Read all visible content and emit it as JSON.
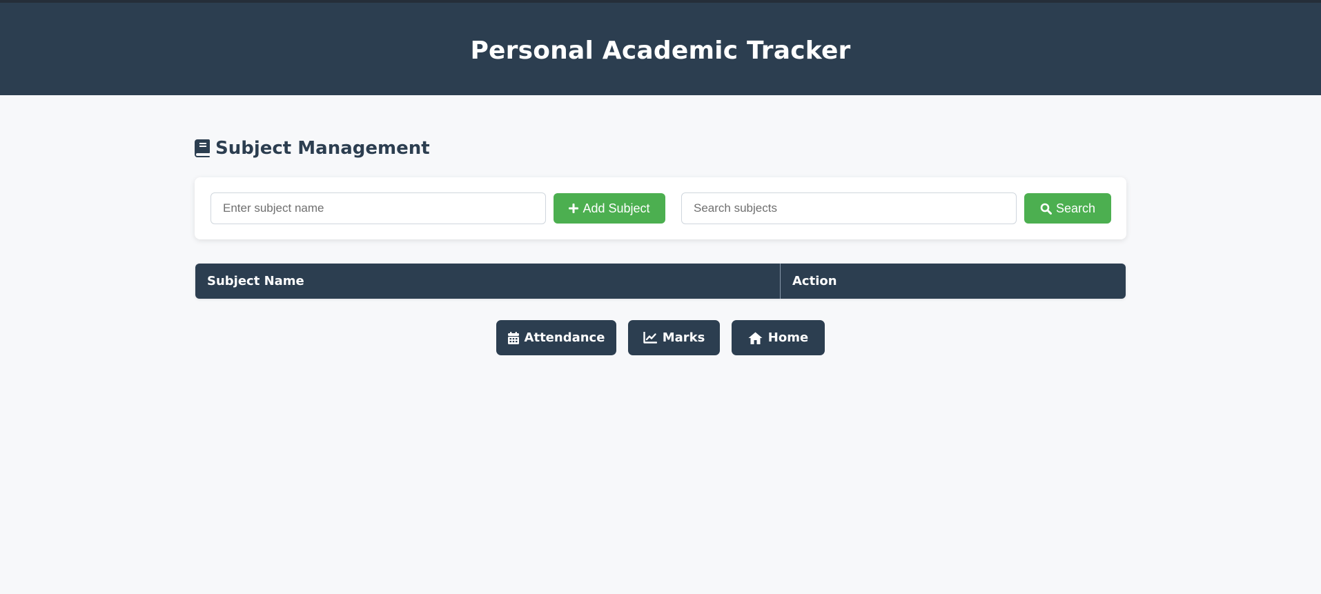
{
  "header": {
    "title": "Personal Academic Tracker"
  },
  "section": {
    "title": "Subject Management",
    "icon": "book-icon"
  },
  "controls": {
    "subject_input": {
      "placeholder": "Enter subject name",
      "value": ""
    },
    "add_button": {
      "label": "Add Subject",
      "icon": "plus-icon"
    },
    "search_input": {
      "placeholder": "Search subjects",
      "value": ""
    },
    "search_button": {
      "label": "Search",
      "icon": "search-icon"
    }
  },
  "table": {
    "columns": [
      "Subject Name",
      "Action"
    ],
    "rows": []
  },
  "nav": {
    "buttons": [
      {
        "label": "Attendance",
        "icon": "calendar-icon"
      },
      {
        "label": "Marks",
        "icon": "chart-line-icon"
      },
      {
        "label": "Home",
        "icon": "home-icon"
      }
    ]
  },
  "colors": {
    "primary": "#2c3e50",
    "accent": "#4caf50",
    "background": "#f7f8fa"
  }
}
